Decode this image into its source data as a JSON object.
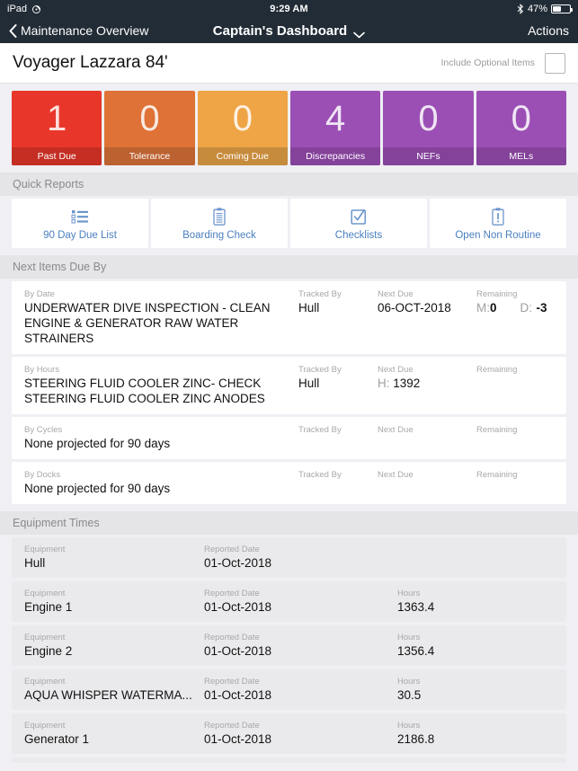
{
  "statusbar": {
    "device": "iPad",
    "rotate_icon": "rotation-lock-icon",
    "time": "9:29 AM",
    "bluetooth_icon": "bluetooth-icon",
    "battery_percent": "47%",
    "battery_icon": "battery-icon"
  },
  "navbar": {
    "back_label": "Maintenance Overview",
    "back_icon": "chevron-left-icon",
    "title": "Captain's Dashboard",
    "title_chevron": "chevron-down-icon",
    "actions_label": "Actions"
  },
  "vessel": {
    "name": "Voyager Lazzara 84'",
    "optional_label": "Include Optional Items",
    "optional_checked": false
  },
  "tiles": [
    {
      "value": "1",
      "label": "Past Due",
      "color": "#E8372A",
      "footer": "#C42E23"
    },
    {
      "value": "0",
      "label": "Tolerance",
      "color": "#DF7236",
      "footer": "#BC6130"
    },
    {
      "value": "0",
      "label": "Coming Due",
      "color": "#EFA445",
      "footer": "#C78B3C"
    },
    {
      "value": "4",
      "label": "Discrepancies",
      "color": "#9B4FB5",
      "footer": "#84429A"
    },
    {
      "value": "0",
      "label": "NEFs",
      "color": "#9B4FB5",
      "footer": "#84429A"
    },
    {
      "value": "0",
      "label": "MELs",
      "color": "#9B4FB5",
      "footer": "#84429A"
    }
  ],
  "quick_reports": {
    "section_title": "Quick Reports",
    "items": [
      {
        "label": "90 Day Due List",
        "icon": "list-icon"
      },
      {
        "label": "Boarding Check",
        "icon": "clipboard-icon"
      },
      {
        "label": "Checklists",
        "icon": "checkbox-check-icon"
      },
      {
        "label": "Open Non Routine",
        "icon": "clipboard-alert-icon"
      }
    ]
  },
  "next_items": {
    "section_title": "Next Items Due By",
    "headers": {
      "tracked_by": "Tracked By",
      "next_due": "Next Due",
      "remaining": "Remaining"
    },
    "rows": [
      {
        "kind": "By Date",
        "title": "UNDERWATER DIVE INSPECTION - CLEAN ENGINE & GENERATOR RAW WATER STRAINERS",
        "tracked_by": "Hull",
        "next_due": "06-OCT-2018",
        "next_due_prefix": "",
        "remaining_months_key": "M:",
        "remaining_months_value": "0",
        "remaining_days_key": "D:",
        "remaining_days_value": "-3"
      },
      {
        "kind": "By Hours",
        "title": "STEERING FLUID COOLER ZINC- CHECK STEERING FLUID COOLER ZINC ANODES",
        "tracked_by": "Hull",
        "next_due": "1392",
        "next_due_prefix": "H:",
        "remaining_months_key": "",
        "remaining_months_value": "",
        "remaining_days_key": "",
        "remaining_days_value": ""
      },
      {
        "kind": "By Cycles",
        "title": "None projected for 90 days",
        "tracked_by": "",
        "next_due": "",
        "next_due_prefix": "",
        "remaining_months_key": "",
        "remaining_months_value": "",
        "remaining_days_key": "",
        "remaining_days_value": ""
      },
      {
        "kind": "By Docks",
        "title": "None projected for 90 days",
        "tracked_by": "",
        "next_due": "",
        "next_due_prefix": "",
        "remaining_months_key": "",
        "remaining_months_value": "",
        "remaining_days_key": "",
        "remaining_days_value": ""
      }
    ]
  },
  "equipment_times": {
    "section_title": "Equipment Times",
    "headers": {
      "equipment": "Equipment",
      "reported_date": "Reported Date",
      "hours": "Hours"
    },
    "rows": [
      {
        "equipment": "Hull",
        "reported_date": "01-Oct-2018",
        "hours": ""
      },
      {
        "equipment": "Engine 1",
        "reported_date": "01-Oct-2018",
        "hours": "1363.4"
      },
      {
        "equipment": "Engine 2",
        "reported_date": "01-Oct-2018",
        "hours": "1356.4"
      },
      {
        "equipment": "AQUA WHISPER WATERMA...",
        "reported_date": "01-Oct-2018",
        "hours": "30.5"
      },
      {
        "equipment": "Generator 1",
        "reported_date": "01-Oct-2018",
        "hours": "2186.8"
      }
    ]
  }
}
